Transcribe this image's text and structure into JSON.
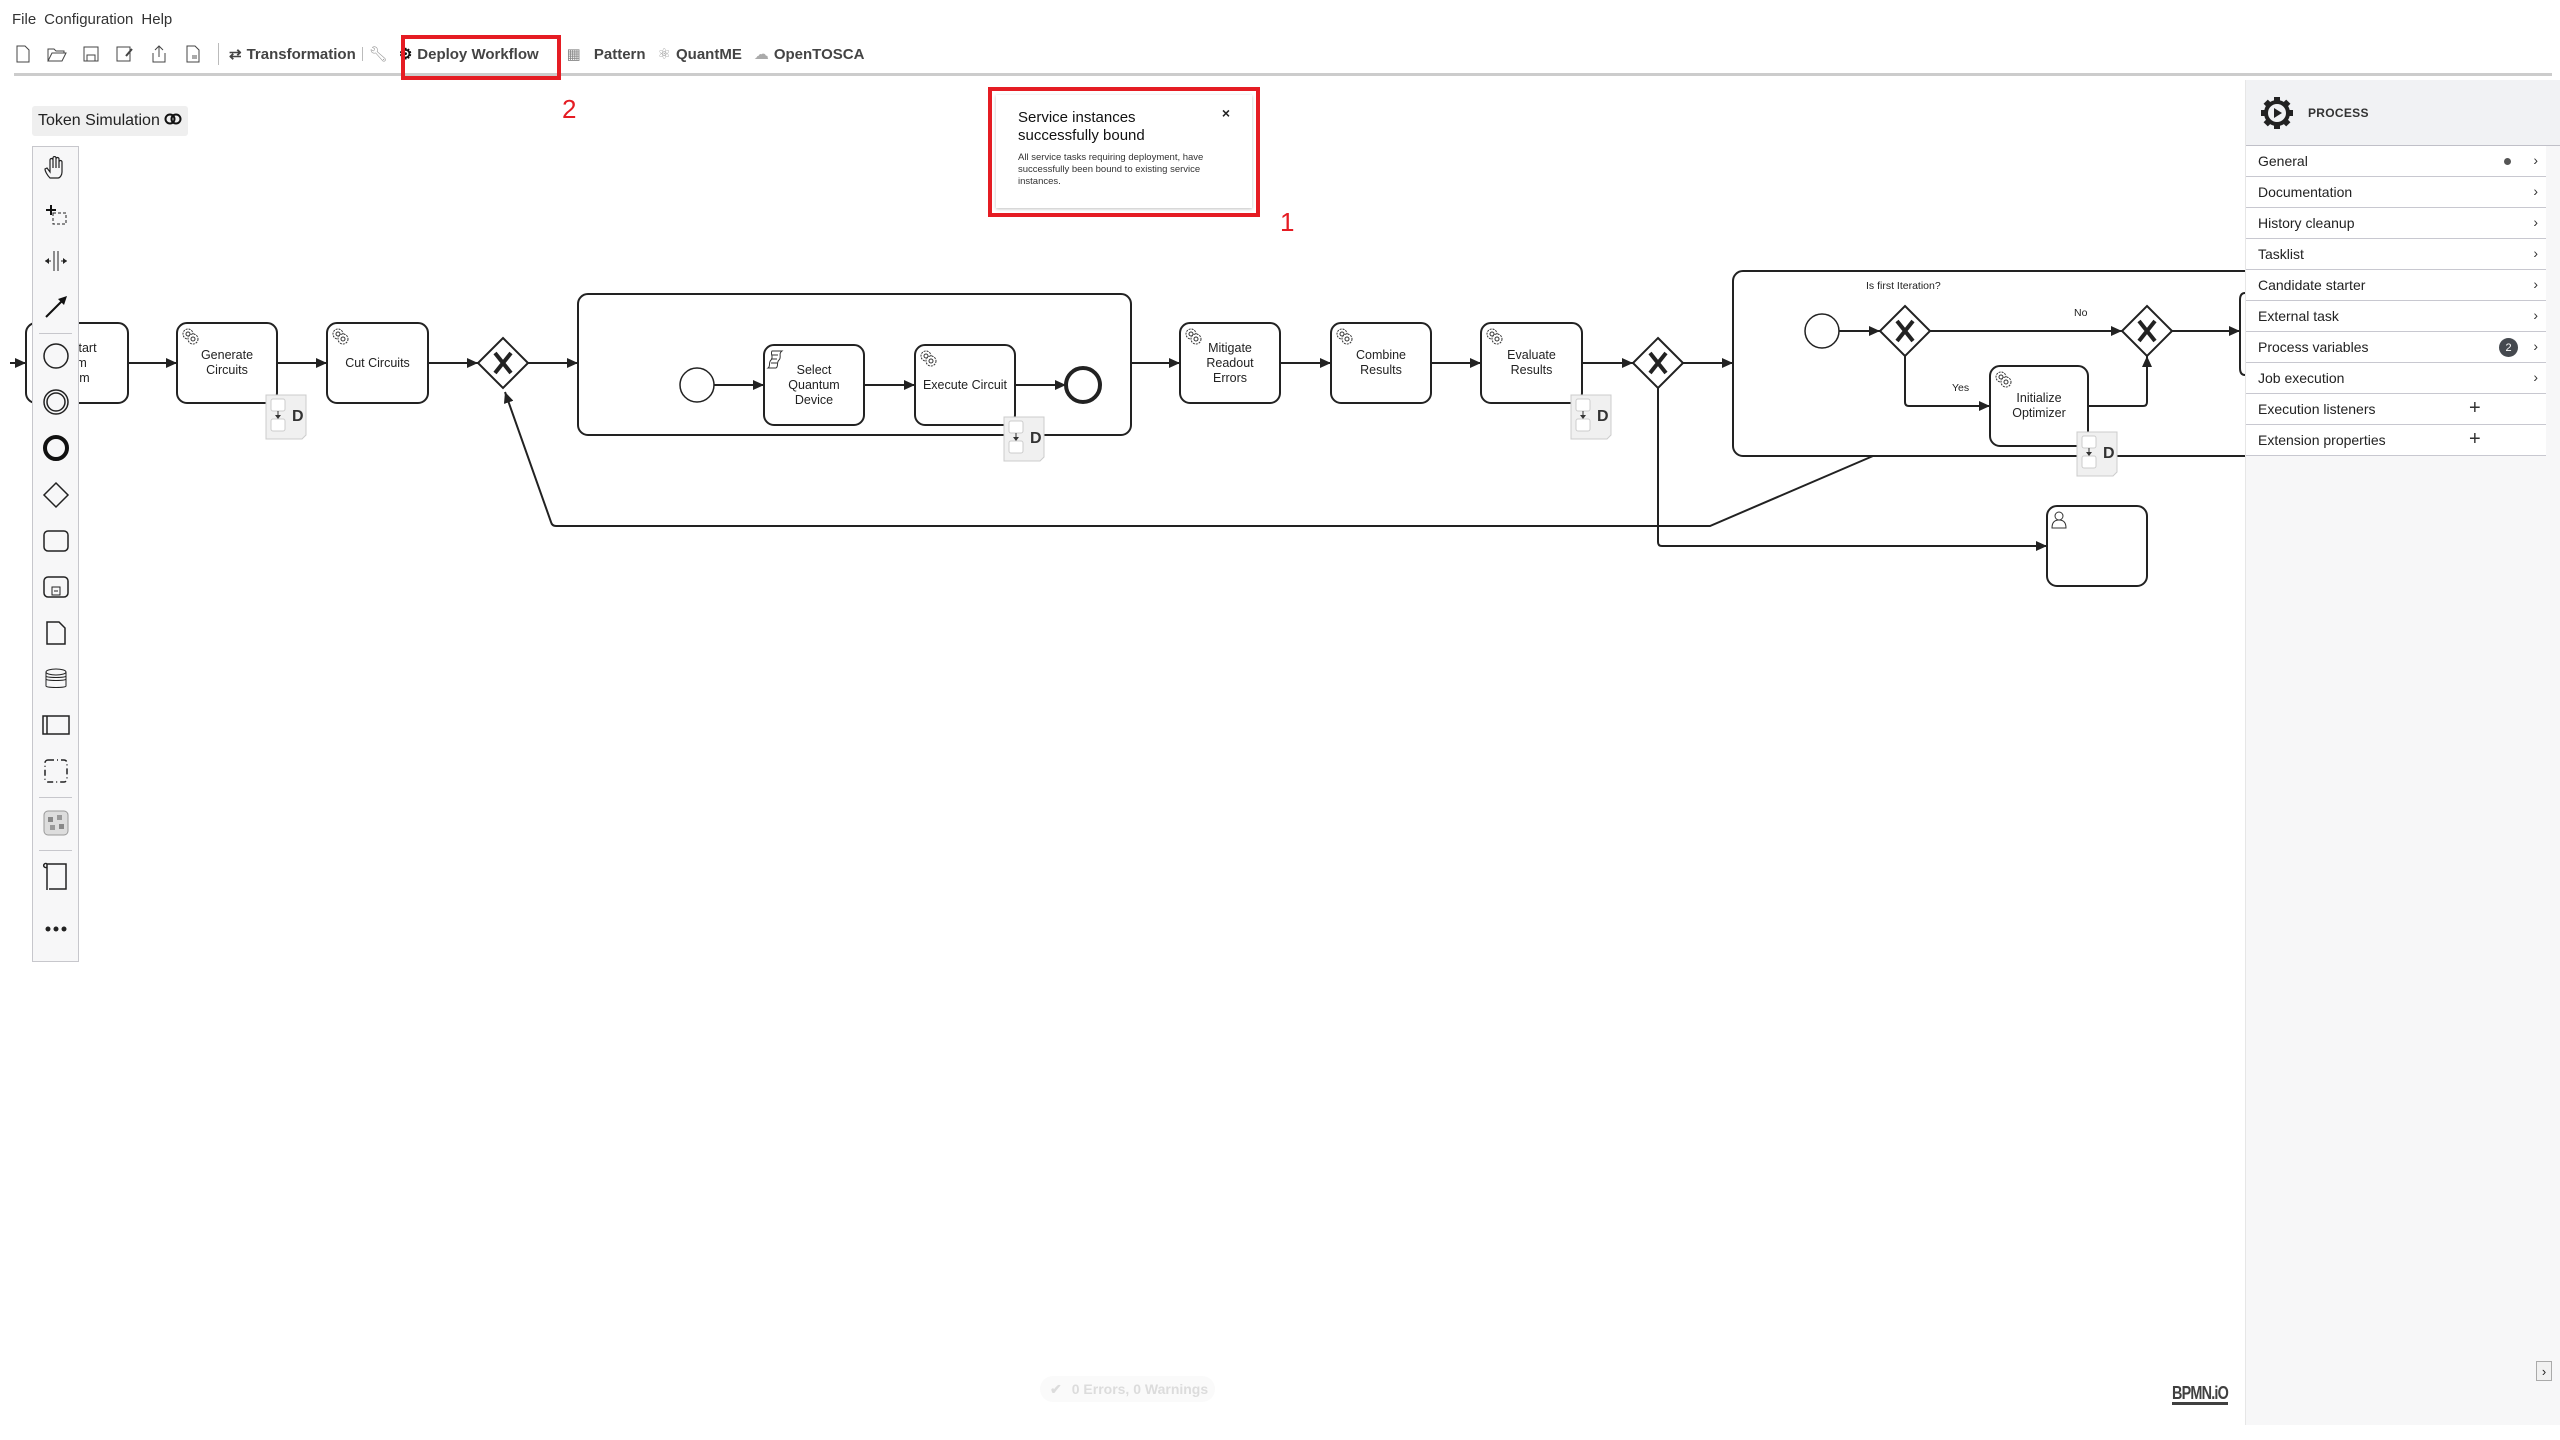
{
  "menu": [
    "File",
    "Configuration",
    "Help"
  ],
  "toolbar": {
    "icons": [
      "new-file-icon",
      "open-folder-icon",
      "save-icon",
      "save-as-icon",
      "export-icon",
      "file-icon"
    ],
    "transformation": "Transformation",
    "deploy": "Deploy Workflow",
    "pattern": "Pattern",
    "quantme": "QuantME",
    "opentosca": "OpenTOSCA"
  },
  "annotations": {
    "deploy_marker": "2",
    "notification_marker": "1",
    "highlight_color": "#e51c23"
  },
  "token_simulation": {
    "label": "Token Simulation"
  },
  "palette": {
    "items": [
      "hand-tool",
      "lasso-tool",
      "space-tool",
      "global-connect-tool",
      "start-event",
      "intermediate-event",
      "end-event",
      "gateway",
      "task",
      "subprocess",
      "data-object",
      "data-store",
      "pool",
      "group",
      "pattern",
      "text-annotation",
      "more"
    ]
  },
  "notification": {
    "title": "Service instances successfully bound",
    "body": "All service tasks requiring deployment, have successfully been bound to existing service instances.",
    "close": "×"
  },
  "diagram": {
    "tasks": {
      "start_algorithm": "Start Quantum Algorithm",
      "start_algorithm_visible": "-Start\ntum\nithm",
      "generate": "Generate Circuits",
      "cut": "Cut Circuits",
      "select": "Select Quantum Device",
      "execute": "Execute Circuit",
      "mitigate": "Mitigate Readout Errors",
      "combine": "Combine Results",
      "evaluate": "Evaluate Results",
      "initialize": "Initialize Optimizer",
      "user_task": ""
    },
    "deployment_marker": "D",
    "gateway_label": "Is first Iteration?",
    "flow_no": "No",
    "flow_yes": "Yes"
  },
  "properties": {
    "header": "PROCESS",
    "groups": [
      {
        "label": "General",
        "dot": true,
        "chevron": true
      },
      {
        "label": "Documentation",
        "chevron": true
      },
      {
        "label": "History cleanup",
        "chevron": true
      },
      {
        "label": "Tasklist",
        "chevron": true
      },
      {
        "label": "Candidate starter",
        "chevron": true
      },
      {
        "label": "External task",
        "chevron": true
      },
      {
        "label": "Process variables",
        "badge": "2",
        "chevron": true
      },
      {
        "label": "Job execution",
        "chevron": true
      },
      {
        "label": "Execution listeners",
        "plus": true
      },
      {
        "label": "Extension properties",
        "plus": true
      }
    ],
    "toggle": "›"
  },
  "linting": {
    "text": "0 Errors, 0 Warnings"
  },
  "logo": "BPMN.iO"
}
